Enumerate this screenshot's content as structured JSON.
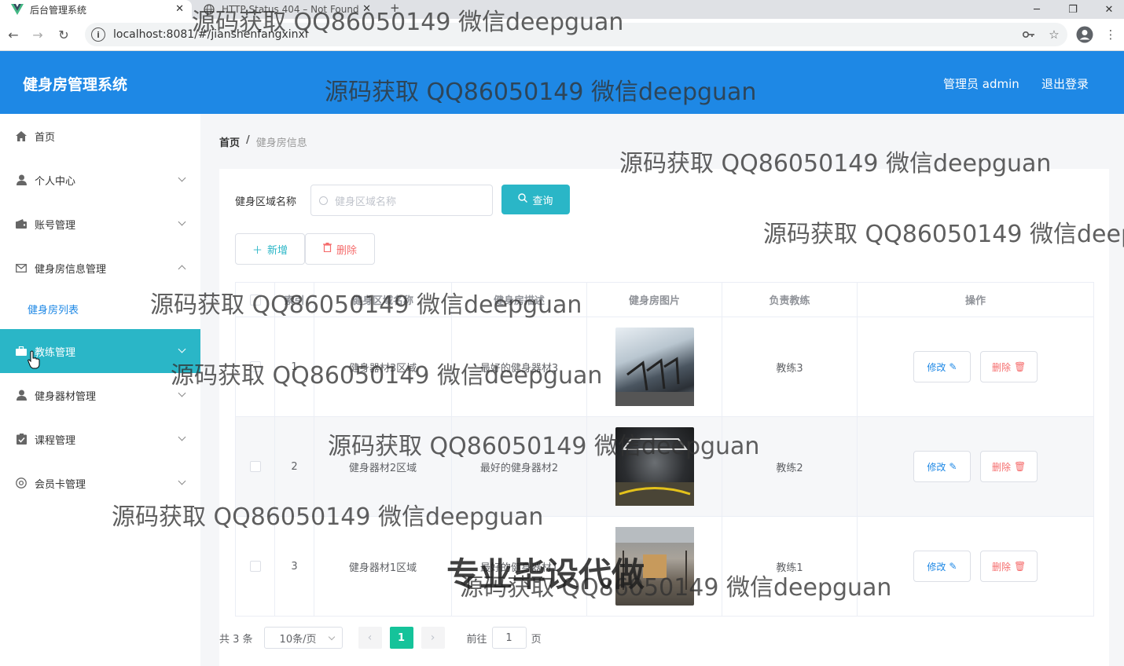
{
  "browser": {
    "active_tab_title": "后台管理系统",
    "inactive_tab_title": "HTTP Status 404 – Not Found",
    "url": "localhost:8081/#/jianshenfangxinxi"
  },
  "header": {
    "title": "健身房管理系统",
    "user_label": "管理员 admin",
    "logout_label": "退出登录",
    "color": "#1e88e5"
  },
  "sidebar": {
    "items": [
      {
        "label": "首页",
        "icon": "home-icon"
      },
      {
        "label": "个人中心",
        "icon": "user-icon"
      },
      {
        "label": "账号管理",
        "icon": "wallet-icon"
      },
      {
        "label": "健身房信息管理",
        "icon": "mail-icon"
      },
      {
        "label": "健身房列表",
        "icon": ""
      },
      {
        "label": "教练管理",
        "icon": "suitcase-icon"
      },
      {
        "label": "健身器材管理",
        "icon": "user-icon"
      },
      {
        "label": "课程管理",
        "icon": "checkbox-icon"
      },
      {
        "label": "会员卡管理",
        "icon": "help-icon"
      }
    ],
    "active_color": "#2ab6c7"
  },
  "breadcrumb": {
    "home": "首页",
    "separator": "/",
    "current": "健身房信息"
  },
  "search": {
    "label": "健身区域名称",
    "placeholder": "健身区域名称",
    "button_label": "查询"
  },
  "actions": {
    "add_label": "新增",
    "delete_label": "删除"
  },
  "table": {
    "columns": [
      "",
      "索引",
      "健身区域名称",
      "健身房描述",
      "健身房图片",
      "负责教练",
      "操作"
    ],
    "rows": [
      {
        "index": "1",
        "area": "健身器材3区域",
        "desc": "最好的健身器材3",
        "coach": "教练3"
      },
      {
        "index": "2",
        "area": "健身器材2区域",
        "desc": "最好的健身器材2",
        "coach": "教练2"
      },
      {
        "index": "3",
        "area": "健身器材1区域",
        "desc": "最好的健身器材1",
        "coach": "教练1"
      }
    ],
    "edit_label": "修改",
    "row_delete_label": "删除"
  },
  "pagination": {
    "total_text": "共 3 条",
    "page_size": "10条/页",
    "current_page": "1",
    "goto_label": "前往",
    "goto_value": "1",
    "page_suffix": "页"
  },
  "watermarks": {
    "text": "源码获取 QQ86050149 微信deepguan",
    "big_text": "专业毕设代做"
  }
}
